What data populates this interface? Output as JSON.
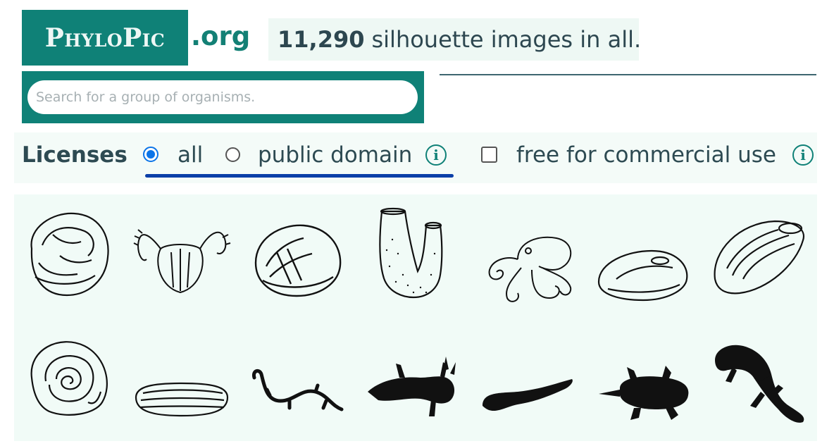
{
  "brand": {
    "logo": "PhyloPic",
    "suffix": ".org"
  },
  "stats": {
    "count": "11,290",
    "text": "silhouette images in all."
  },
  "search": {
    "placeholder": "Search for a group of organisms."
  },
  "licenses": {
    "label": "Licenses",
    "options": [
      {
        "label": "all",
        "selected": true
      },
      {
        "label": "public domain",
        "selected": false
      },
      {
        "label": "free for commercial use",
        "checked": false
      }
    ],
    "info_icon": "info-icon",
    "accent": "#0f8177",
    "radio_color": "#0b74e8"
  },
  "gallery": {
    "items": [
      {
        "name": "oyster-icon"
      },
      {
        "name": "barnacle-icon"
      },
      {
        "name": "clam-icon"
      },
      {
        "name": "tunicate-icon"
      },
      {
        "name": "octopus-icon"
      },
      {
        "name": "mussel-icon"
      },
      {
        "name": "oyster-shell-icon"
      },
      {
        "name": "snail-shell-icon"
      },
      {
        "name": "razor-clam-icon"
      },
      {
        "name": "salamander-icon"
      },
      {
        "name": "axolotl-icon"
      },
      {
        "name": "eel-icon"
      },
      {
        "name": "toad-icon"
      },
      {
        "name": "gecko-icon"
      }
    ]
  },
  "colors": {
    "teal": "#0f8177",
    "text": "#2f4a52",
    "panel": "#f1fbf7"
  }
}
